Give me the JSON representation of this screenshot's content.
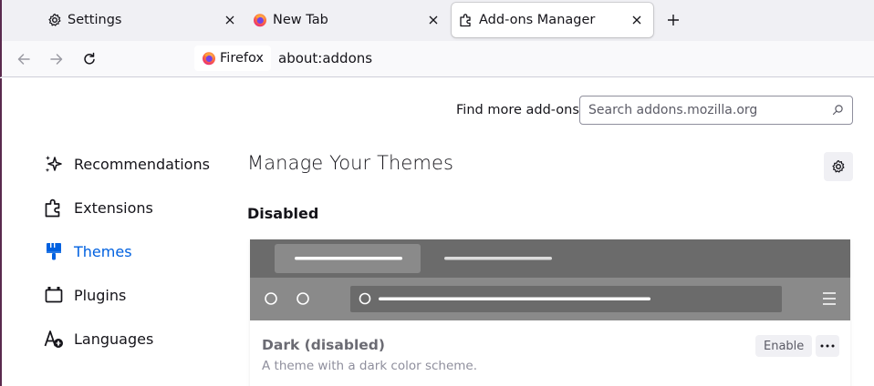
{
  "colors": {
    "accent": "#0061e0",
    "tab_strip": "#f0f0f4",
    "preview_frame": "#6b6b6b",
    "preview_toolbar": "#8a8a8a"
  },
  "tabs": [
    {
      "label": "Settings",
      "icon": "gear-icon",
      "active": false
    },
    {
      "label": "New Tab",
      "icon": "firefox-icon",
      "active": false
    },
    {
      "label": "Add-ons Manager",
      "icon": "puzzle-icon",
      "active": true
    }
  ],
  "navbar": {
    "identity_label": "Firefox",
    "url": "about:addons"
  },
  "header": {
    "find_more_label": "Find more add-ons",
    "search_placeholder": "Search addons.mozilla.org"
  },
  "sidebar": {
    "items": [
      {
        "label": "Recommendations",
        "icon": "sparkle-icon"
      },
      {
        "label": "Extensions",
        "icon": "puzzle-icon"
      },
      {
        "label": "Themes",
        "icon": "brush-icon",
        "selected": true
      },
      {
        "label": "Plugins",
        "icon": "plugin-icon"
      },
      {
        "label": "Languages",
        "icon": "language-icon"
      }
    ]
  },
  "main": {
    "title": "Manage Your Themes",
    "section_title": "Disabled",
    "theme_card": {
      "name": "Dark (disabled)",
      "description": "A theme with a dark color scheme.",
      "enable_label": "Enable"
    }
  }
}
